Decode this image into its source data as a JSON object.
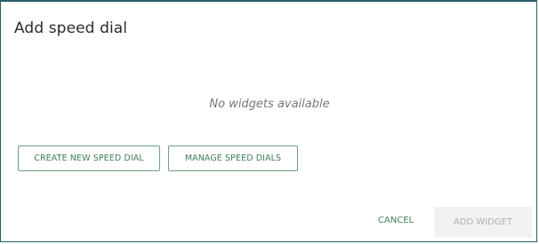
{
  "dialog": {
    "title": "Add speed dial",
    "empty_message": "No widgets available",
    "create_button": "CREATE NEW SPEED DIAL",
    "manage_button": "MANAGE SPEED DIALS",
    "cancel_button": "CANCEL",
    "add_button": "ADD WIDGET"
  },
  "colors": {
    "border": "#2e5f6b",
    "accent": "#3f7f58",
    "disabled_bg": "#f2f2f2",
    "disabled_text": "#b0b0b0"
  }
}
